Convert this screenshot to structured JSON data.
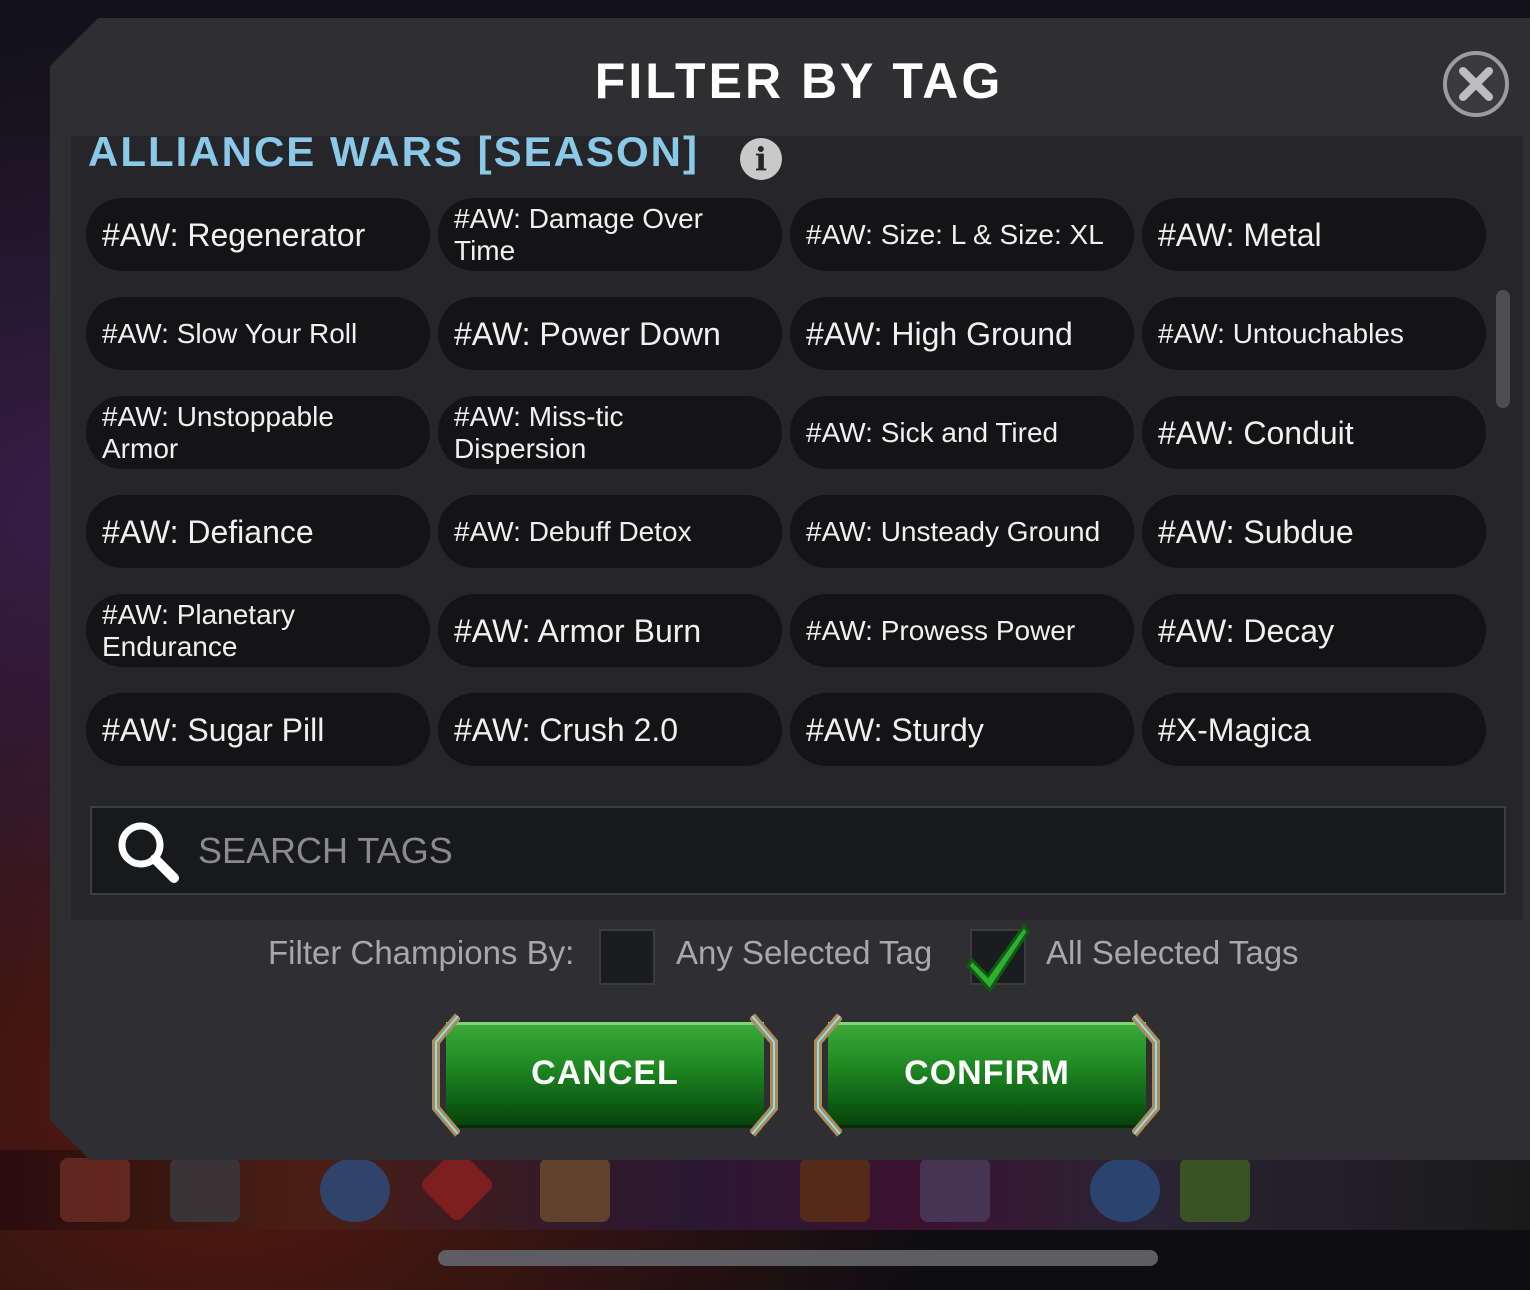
{
  "modal": {
    "title": "FILTER BY TAG",
    "close_icon": "close-icon"
  },
  "section": {
    "title": "ALLIANCE WARS [SEASON]",
    "info_icon_glyph": "i"
  },
  "tags": [
    "#AW: Regenerator",
    "#AW: Damage Over Time",
    "#AW: Size: L & Size: XL",
    "#AW: Metal",
    "#AW: Slow Your Roll",
    "#AW: Power Down",
    "#AW: High Ground",
    "#AW: Untouchables",
    "#AW: Unstoppable Armor",
    "#AW: Miss-tic Dispersion",
    "#AW: Sick and Tired",
    "#AW: Conduit",
    "#AW: Defiance",
    "#AW: Debuff Detox",
    "#AW: Unsteady Ground",
    "#AW: Subdue",
    "#AW: Planetary Endurance",
    "#AW: Armor Burn",
    "#AW: Prowess Power",
    "#AW: Decay",
    "#AW: Sugar Pill",
    "#AW: Crush 2.0",
    "#AW: Sturdy",
    "#X-Magica"
  ],
  "search": {
    "placeholder": "SEARCH TAGS",
    "icon": "search-icon"
  },
  "filter": {
    "label": "Filter Champions By:",
    "any_label": "Any Selected Tag",
    "any_checked": false,
    "all_label": "All Selected Tags",
    "all_checked": true
  },
  "buttons": {
    "cancel": "CANCEL",
    "confirm": "CONFIRM"
  },
  "colors": {
    "section_title": "#8ac9ea",
    "button_green": "#1f8a22",
    "checkmark": "#2fae2f",
    "panel": "#2f2f31"
  }
}
